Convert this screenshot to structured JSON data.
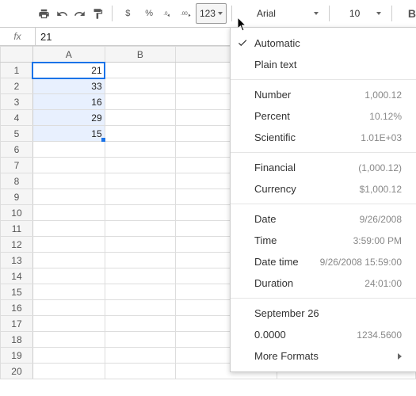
{
  "toolbar": {
    "format_btn_label": "123",
    "font": "Arial",
    "font_size": "10",
    "bold_label": "B",
    "dollar": "$",
    "percent": "%"
  },
  "formula_bar": {
    "label": "fx",
    "value": "21"
  },
  "columns": [
    "A",
    "B"
  ],
  "rows": [
    "1",
    "2",
    "3",
    "4",
    "5",
    "6",
    "7",
    "8",
    "9",
    "10",
    "11",
    "12",
    "13",
    "14",
    "15",
    "16",
    "17",
    "18",
    "19",
    "20"
  ],
  "cells": {
    "A1": "21",
    "A2": "33",
    "A3": "16",
    "A4": "29",
    "A5": "15"
  },
  "menu": {
    "automatic": "Automatic",
    "plain_text": "Plain text",
    "number": {
      "label": "Number",
      "sample": "1,000.12"
    },
    "percent": {
      "label": "Percent",
      "sample": "10.12%"
    },
    "scientific": {
      "label": "Scientific",
      "sample": "1.01E+03"
    },
    "financial": {
      "label": "Financial",
      "sample": "(1,000.12)"
    },
    "currency": {
      "label": "Currency",
      "sample": "$1,000.12"
    },
    "date": {
      "label": "Date",
      "sample": "9/26/2008"
    },
    "time": {
      "label": "Time",
      "sample": "3:59:00 PM"
    },
    "datetime": {
      "label": "Date time",
      "sample": "9/26/2008 15:59:00"
    },
    "duration": {
      "label": "Duration",
      "sample": "24:01:00"
    },
    "custom_date": "September 26",
    "custom_num": {
      "label": "0.0000",
      "sample": "1234.5600"
    },
    "more": "More Formats"
  }
}
